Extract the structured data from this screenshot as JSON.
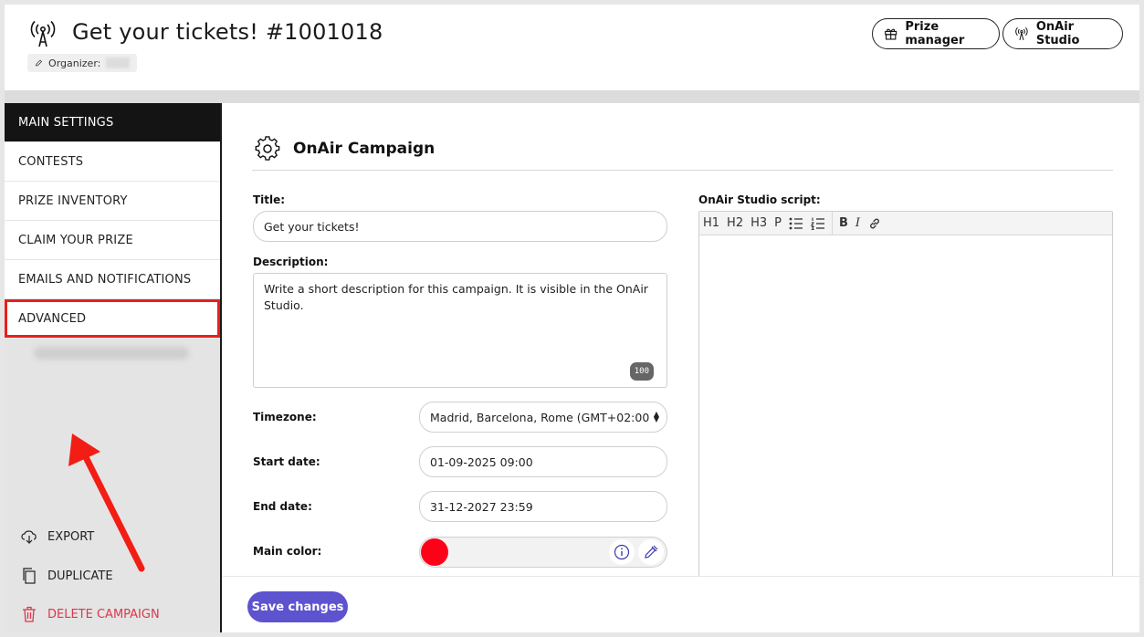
{
  "header": {
    "title": "Get your tickets! #1001018",
    "organizer_label": "Organizer:",
    "prize_manager_label": "Prize manager",
    "onair_studio_label": "OnAir Studio"
  },
  "sidebar": {
    "items": [
      {
        "label": "MAIN SETTINGS"
      },
      {
        "label": "CONTESTS"
      },
      {
        "label": "PRIZE INVENTORY"
      },
      {
        "label": "CLAIM YOUR PRIZE"
      },
      {
        "label": "EMAILS AND NOTIFICATIONS"
      },
      {
        "label": "ADVANCED"
      }
    ],
    "export_label": "EXPORT",
    "duplicate_label": "DUPLICATE",
    "delete_label": "DELETE CAMPAIGN"
  },
  "main": {
    "section_title": "OnAir Campaign",
    "title_label": "Title:",
    "title_value": "Get your tickets!",
    "description_label": "Description:",
    "description_value": "Write a short description for this campaign. It is visible in the OnAir Studio.",
    "description_counter": "100",
    "timezone_label": "Timezone:",
    "timezone_value": "Madrid, Barcelona, Rome (GMT+02:00",
    "start_date_label": "Start date:",
    "start_date_value": "01-09-2025 09:00",
    "end_date_label": "End date:",
    "end_date_value": "31-12-2027 23:59",
    "main_color_label": "Main color:",
    "main_color_value": "#ff0019",
    "script_label": "OnAir Studio script:",
    "toolbar": {
      "h1": "H1",
      "h2": "H2",
      "h3": "H3",
      "p": "P",
      "bold": "B",
      "italic": "I"
    },
    "save_label": "Save changes"
  },
  "colors": {
    "accent": "#5e53cf",
    "danger": "#d8384b",
    "highlight": "#e8201a"
  }
}
